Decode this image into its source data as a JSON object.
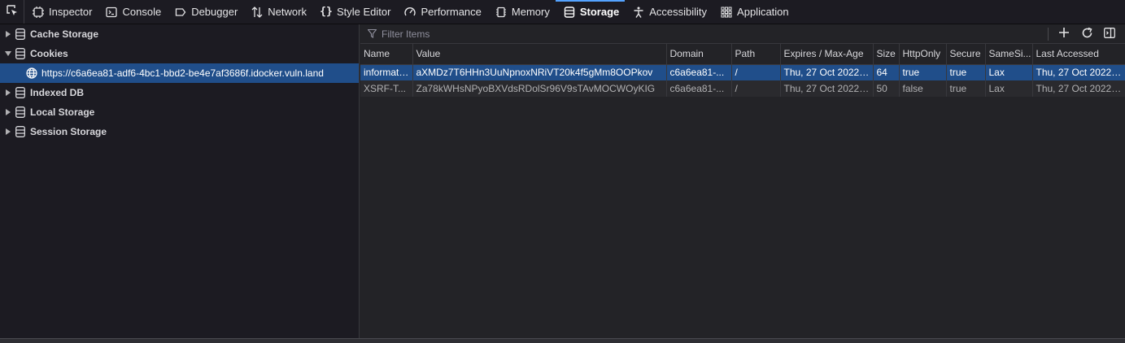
{
  "toolbar": {
    "tabs": [
      {
        "label": "Inspector",
        "icon": "inspector-icon"
      },
      {
        "label": "Console",
        "icon": "console-icon"
      },
      {
        "label": "Debugger",
        "icon": "debugger-icon"
      },
      {
        "label": "Network",
        "icon": "network-icon"
      },
      {
        "label": "Style Editor",
        "icon": "style-editor-icon"
      },
      {
        "label": "Performance",
        "icon": "performance-icon"
      },
      {
        "label": "Memory",
        "icon": "memory-icon"
      },
      {
        "label": "Storage",
        "icon": "storage-icon"
      },
      {
        "label": "Accessibility",
        "icon": "accessibility-icon"
      },
      {
        "label": "Application",
        "icon": "application-icon"
      }
    ],
    "selected": "Storage"
  },
  "sidebar": {
    "items": [
      {
        "label": "Cache Storage",
        "expanded": false
      },
      {
        "label": "Cookies",
        "expanded": true
      },
      {
        "label": "https://c6a6ea81-adf6-4bc1-bbd2-be4e7af3686f.idocker.vuln.land",
        "child": true,
        "selected": true
      },
      {
        "label": "Indexed DB",
        "expanded": false
      },
      {
        "label": "Local Storage",
        "expanded": false
      },
      {
        "label": "Session Storage",
        "expanded": false
      }
    ]
  },
  "filter": {
    "placeholder": "Filter Items"
  },
  "table": {
    "columns": [
      "Name",
      "Value",
      "Domain",
      "Path",
      "Expires / Max-Age",
      "Size",
      "HttpOnly",
      "Secure",
      "SameSi...",
      "Last Accessed"
    ],
    "rows": [
      [
        "informati...",
        "aXMDz7T6HHn3UuNpnoxNRiVT20k4f5gMm8OOPkov",
        "c6a6ea81-...",
        "/",
        "Thu, 27 Oct 2022 ...",
        "64",
        "true",
        "true",
        "Lax",
        "Thu, 27 Oct 2022 ..."
      ],
      [
        "XSRF-T...",
        "Za78kWHsNPyoBXVdsRDolSr96V9sTAvMOCWOyKIG",
        "c6a6ea81-...",
        "/",
        "Thu, 27 Oct 2022 ...",
        "50",
        "false",
        "true",
        "Lax",
        "Thu, 27 Oct 2022 ..."
      ]
    ]
  },
  "colors": {
    "accent": "#54a3ff",
    "selection": "#204e8a",
    "background": "#232327"
  }
}
